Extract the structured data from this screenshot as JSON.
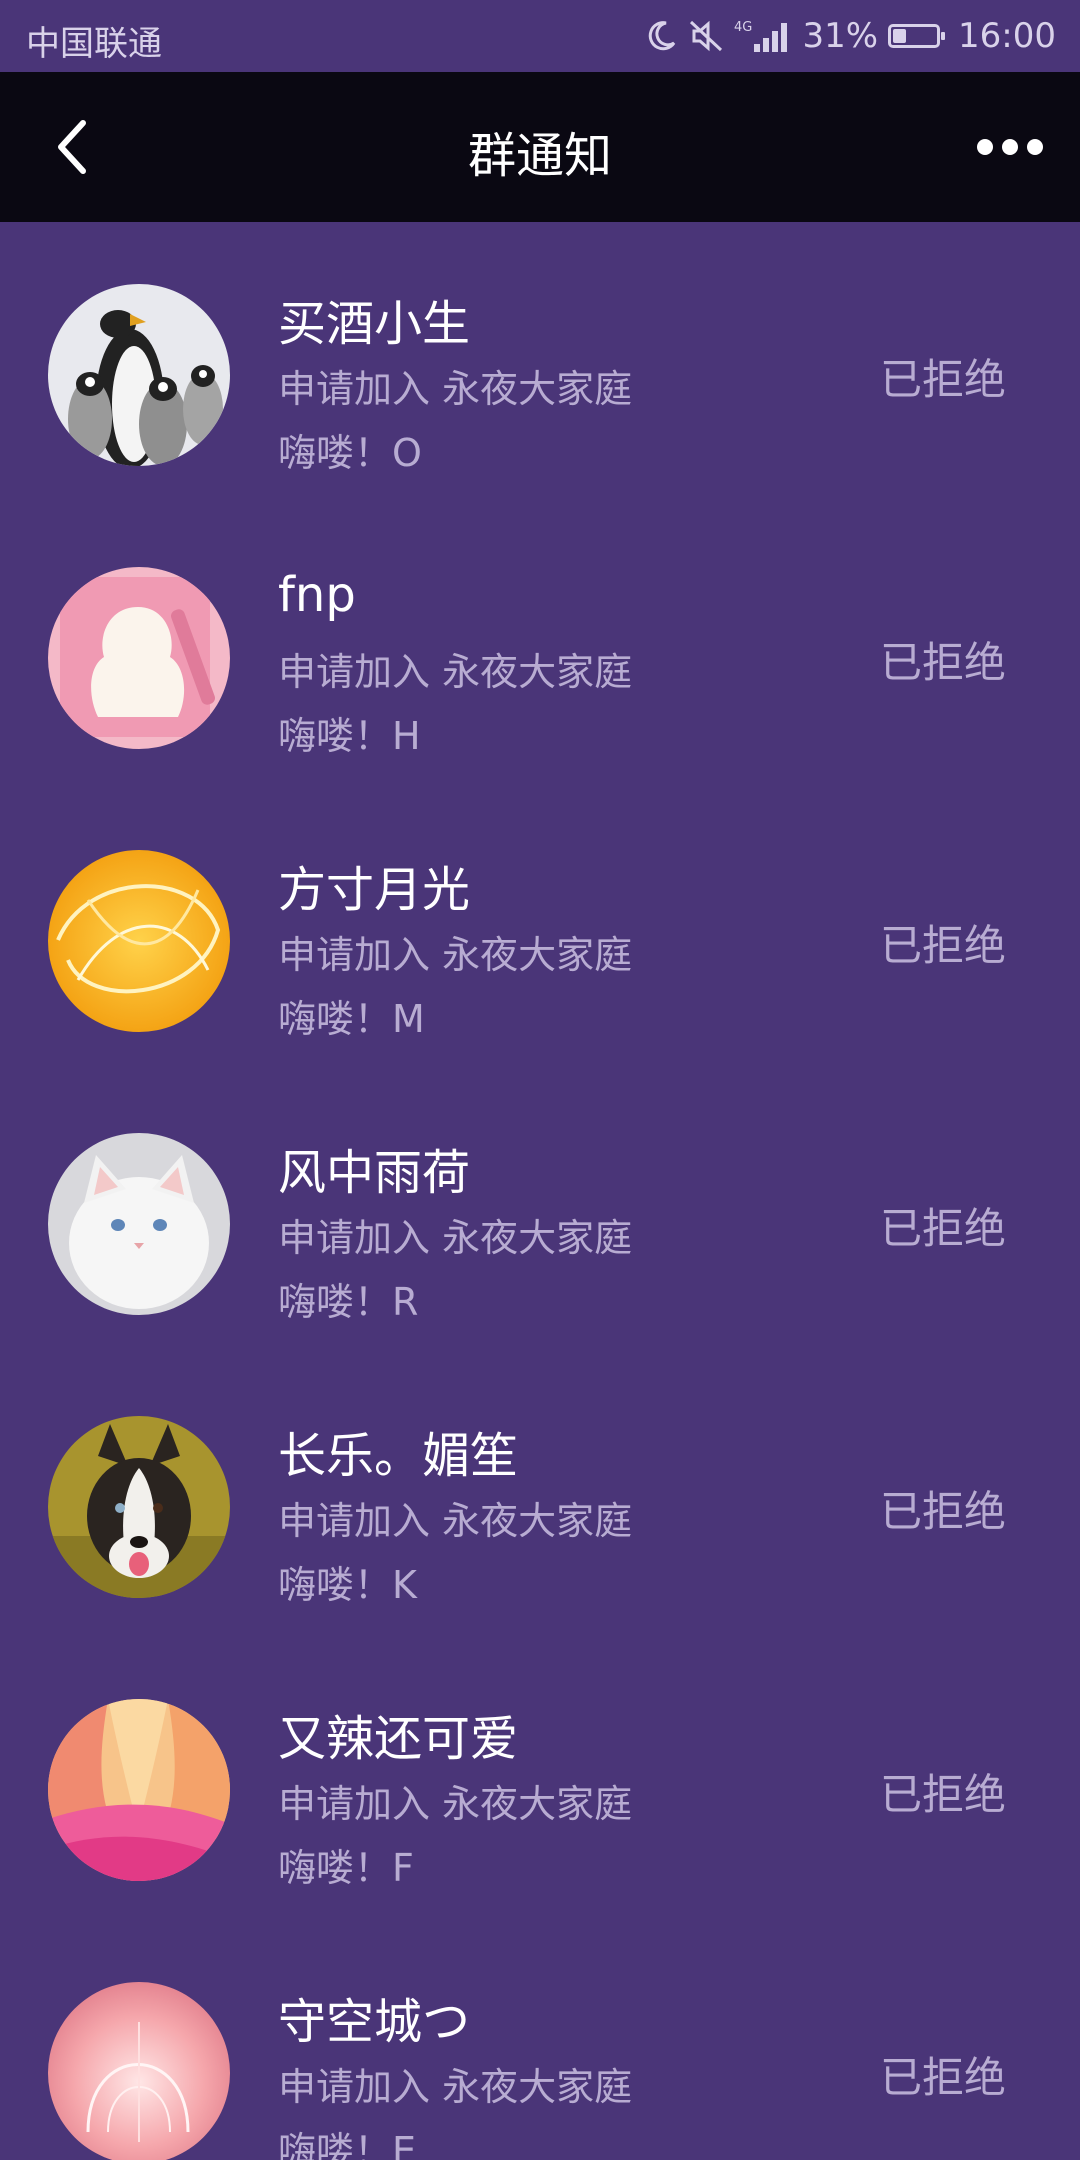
{
  "status_bar": {
    "carrier": "中国联通",
    "network": "4G",
    "battery": "31%",
    "battery_level": 0.31,
    "time": "16:00",
    "icons": [
      "moon-icon",
      "mute-icon",
      "signal-icon",
      "battery-icon"
    ]
  },
  "nav": {
    "title": "群通知",
    "back_icon": "chevron-left-icon",
    "more_icon": "more-dots-icon"
  },
  "notifications": [
    {
      "name": "买酒小生",
      "apply": "申请加入 永夜大家庭",
      "message": "嗨喽！O",
      "status": "已拒绝",
      "avatar": "penguins"
    },
    {
      "name": "fnp",
      "apply": "申请加入 永夜大家庭",
      "message": "嗨喽！H",
      "status": "已拒绝",
      "avatar": "pink-silhouette"
    },
    {
      "name": "方寸月光",
      "apply": "申请加入 永夜大家庭",
      "message": "嗨喽！M",
      "status": "已拒绝",
      "avatar": "orange-swirl"
    },
    {
      "name": "风中雨荷",
      "apply": "申请加入 永夜大家庭",
      "message": "嗨喽！R",
      "status": "已拒绝",
      "avatar": "white-cat"
    },
    {
      "name": "长乐。媚笙",
      "apply": "申请加入 永夜大家庭",
      "message": "嗨喽！K",
      "status": "已拒绝",
      "avatar": "husky-dog"
    },
    {
      "name": "又辣还可爱",
      "apply": "申请加入 永夜大家庭",
      "message": "嗨喽！F",
      "status": "已拒绝",
      "avatar": "pink-petals"
    },
    {
      "name": "守空城つ",
      "apply": "申请加入 永夜大家庭",
      "message": "嗨喽！E",
      "status": "已拒绝",
      "avatar": "pink-glow"
    }
  ],
  "colors": {
    "background": "#4a3578",
    "nav_background": "#0a0812",
    "primary_text": "#ffffff",
    "secondary_text": "#b8acd2"
  }
}
